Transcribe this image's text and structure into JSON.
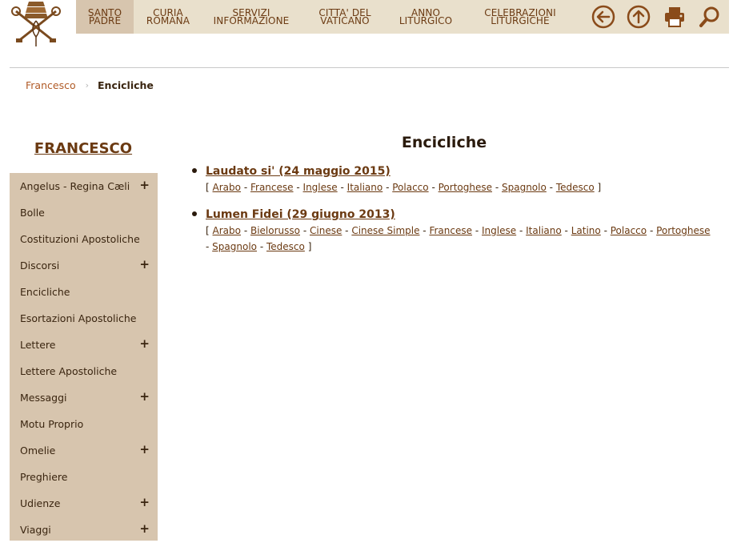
{
  "topnav": {
    "items": [
      {
        "label": "SANTO\nPADRE",
        "active": true
      },
      {
        "label": "CURIA\nROMANA"
      },
      {
        "label": "SERVIZI\nINFORMAZIONE"
      },
      {
        "label": "CITTA' DEL\nVATICANO"
      },
      {
        "label": "ANNO\nLITURGICO"
      },
      {
        "label": "CELEBRAZIONI\nLITURGICHE"
      }
    ],
    "tools": [
      "back-arrow-icon",
      "up-arrow-icon",
      "print-icon",
      "search-icon"
    ]
  },
  "breadcrumb": {
    "parent": "Francesco",
    "separator": "›",
    "current": "Encicliche"
  },
  "sidebar": {
    "title": "FRANCESCO",
    "items": [
      {
        "label": "Angelus - Regina Cæli",
        "plus": "+"
      },
      {
        "label": "Bolle"
      },
      {
        "label": "Costituzioni Apostoliche"
      },
      {
        "label": "Discorsi",
        "plus": "+"
      },
      {
        "label": "Encicliche"
      },
      {
        "label": "Esortazioni Apostoliche"
      },
      {
        "label": "Lettere",
        "plus": "+"
      },
      {
        "label": "Lettere Apostoliche"
      },
      {
        "label": "Messaggi",
        "plus": "+"
      },
      {
        "label": "Motu Proprio"
      },
      {
        "label": "Omelie",
        "plus": "+"
      },
      {
        "label": "Preghiere"
      },
      {
        "label": "Udienze",
        "plus": "+"
      },
      {
        "label": "Viaggi",
        "plus": "+"
      }
    ]
  },
  "main": {
    "title": "Encicliche",
    "entries": [
      {
        "title": "Laudato si' (24 maggio 2015)",
        "languages": [
          "Arabo",
          "Francese",
          "Inglese",
          "Italiano",
          "Polacco",
          "Portoghese",
          "Spagnolo",
          "Tedesco"
        ]
      },
      {
        "title": "Lumen Fidei (29 giugno 2013)",
        "languages": [
          "Arabo",
          "Bielorusso",
          "Cinese",
          "Cinese Simple",
          "Francese",
          "Inglese",
          "Italiano",
          "Latino",
          "Polacco",
          "Portoghese",
          "Spagnolo",
          "Tedesco"
        ]
      }
    ],
    "bracket_open": "[",
    "bracket_close": "]",
    "lang_separator": "-"
  },
  "colors": {
    "nav_bg": "#e9e0cc",
    "nav_active": "#d7c5ae",
    "sidebar_bg": "#d7c5ae",
    "link_brown": "#6b3a12",
    "breadcrumb_link": "#b05a26",
    "icon_brown": "#8a4b1a"
  }
}
